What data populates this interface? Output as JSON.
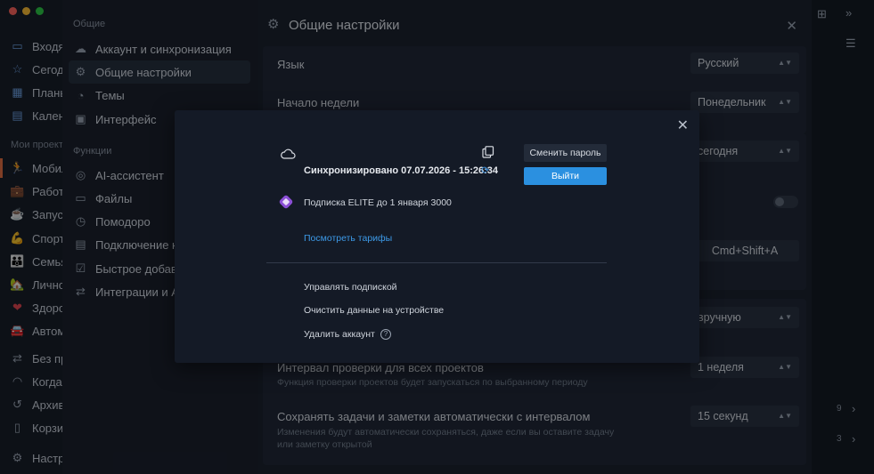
{
  "window": {
    "traffic_colors": [
      "#ff5f57",
      "#febc2e",
      "#28c840"
    ]
  },
  "app_sidebar": {
    "items_top": [
      {
        "label": "Входя",
        "icon": "inbox-icon"
      },
      {
        "label": "Сегод",
        "icon": "star-icon"
      },
      {
        "label": "Планы",
        "icon": "calendar-plan-icon"
      },
      {
        "label": "Кален",
        "icon": "calendar-icon"
      }
    ],
    "projects_heading": "Мои проекты",
    "projects": [
      {
        "label": "Мобил",
        "icon": "runner-emoji-icon",
        "emoji": "🏃"
      },
      {
        "label": "Работа",
        "icon": "briefcase-emoji-icon",
        "emoji": "💼"
      },
      {
        "label": "Запусі",
        "icon": "rocket-emoji-icon",
        "emoji": "☕"
      },
      {
        "label": "Спорт",
        "icon": "muscle-emoji-icon",
        "emoji": "💪"
      },
      {
        "label": "Семья",
        "icon": "family-emoji-icon",
        "emoji": "👪"
      },
      {
        "label": "Лично",
        "icon": "house-emoji-icon",
        "emoji": "🏡"
      },
      {
        "label": "Здоро",
        "icon": "heart-emoji-icon",
        "emoji": "❤"
      },
      {
        "label": "Автом",
        "icon": "car-emoji-icon",
        "emoji": "🚘"
      }
    ],
    "items_bottom": [
      {
        "label": "Без пр",
        "icon": "shuffle-icon"
      },
      {
        "label": "Когда",
        "icon": "rainbow-icon"
      },
      {
        "label": "Архив",
        "icon": "history-icon"
      },
      {
        "label": "Корзи",
        "icon": "trash-icon"
      }
    ],
    "settings_label": "Настр"
  },
  "settings_nav": {
    "general_heading": "Общие",
    "general_items": [
      {
        "label": "Аккаунт и синхронизация",
        "icon": "cloud-icon"
      },
      {
        "label": "Общие настройки",
        "icon": "gear-icon"
      },
      {
        "label": "Темы",
        "icon": "palette-icon"
      },
      {
        "label": "Интерфейс",
        "icon": "layout-icon"
      }
    ],
    "functions_heading": "Функции",
    "function_items": [
      {
        "label": "AI-ассистент",
        "icon": "ai-icon"
      },
      {
        "label": "Файлы",
        "icon": "folder-icon"
      },
      {
        "label": "Помодоро",
        "icon": "timer-icon"
      },
      {
        "label": "Подключение ка",
        "icon": "calendar-connect-icon"
      },
      {
        "label": "Быстрое добавл",
        "icon": "quick-add-icon"
      },
      {
        "label": "Интеграции и AP",
        "icon": "integrations-icon"
      }
    ]
  },
  "main": {
    "title": "Общие настройки",
    "rows": {
      "language": {
        "label": "Язык",
        "value": "Русский"
      },
      "week_start": {
        "label": "Начало недели",
        "value": "Понедельник"
      },
      "default_date": {
        "value": "сегодня"
      },
      "shortcut": {
        "value": "Cmd+Shift+A"
      },
      "mode": {
        "value": "вручную"
      },
      "check_interval": {
        "label": "Интервал проверки для всех проектов",
        "desc": "Функция проверки проектов будет запускаться по выбранному периоду",
        "value": "1 неделя"
      },
      "autosave": {
        "label": "Сохранять задачи и заметки автоматически с интервалом",
        "desc_1": "Изменения будут автоматически сохраняться, даже если вы оставите задачу",
        "desc_2": "или заметку открытой",
        "value": "15 секунд"
      }
    }
  },
  "right_rail": {
    "counts": [
      "9",
      "3"
    ]
  },
  "modal": {
    "sync_status": "Синхронизировано 07.07.2026 - 15:26:34",
    "change_password": "Сменить пароль",
    "logout": "Выйти",
    "subscription": "Подписка ELITE до 1 января 3000",
    "view_plans": "Посмотреть тарифы",
    "manage_subscription": "Управлять подпиской",
    "clear_data": "Очистить данные на устройстве",
    "delete_account": "Удалить аккаунт",
    "help_glyph": "?"
  }
}
